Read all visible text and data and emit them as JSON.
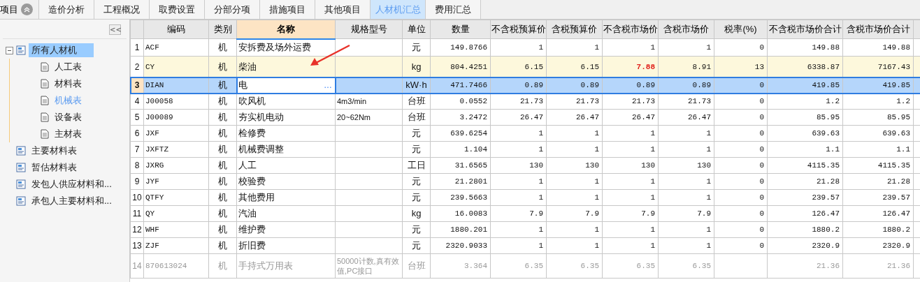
{
  "tabs": {
    "cut_label": "项目",
    "items": [
      {
        "label": "造价分析",
        "selected": false
      },
      {
        "label": "工程概况",
        "selected": false
      },
      {
        "label": "取费设置",
        "selected": false
      },
      {
        "label": "分部分项",
        "selected": false
      },
      {
        "label": "措施项目",
        "selected": false
      },
      {
        "label": "其他项目",
        "selected": false
      },
      {
        "label": "人材机汇总",
        "selected": true
      },
      {
        "label": "费用汇总",
        "selected": false
      }
    ]
  },
  "sidebar": {
    "collapse_button": "<<",
    "tree": [
      {
        "label": "所有人材机",
        "kind": "group",
        "selected": true,
        "active": false,
        "expanded": true,
        "children": [
          {
            "label": "人工表",
            "kind": "page",
            "selected": false,
            "active": false
          },
          {
            "label": "材料表",
            "kind": "page",
            "selected": false,
            "active": false
          },
          {
            "label": "机械表",
            "kind": "page",
            "selected": false,
            "active": true
          },
          {
            "label": "设备表",
            "kind": "page",
            "selected": false,
            "active": false
          },
          {
            "label": "主材表",
            "kind": "page",
            "selected": false,
            "active": false
          }
        ]
      },
      {
        "label": "主要材料表",
        "kind": "group",
        "selected": false,
        "active": false
      },
      {
        "label": "暂估材料表",
        "kind": "group",
        "selected": false,
        "active": false
      },
      {
        "label": "发包人供应材料和...",
        "kind": "group",
        "selected": false,
        "active": false
      },
      {
        "label": "承包人主要材料和...",
        "kind": "group",
        "selected": false,
        "active": false
      }
    ]
  },
  "table": {
    "columns": [
      {
        "label": "编码",
        "sorted": false
      },
      {
        "label": "类别",
        "sorted": false
      },
      {
        "label": "名称",
        "sorted": true
      },
      {
        "label": "规格型号",
        "sorted": false
      },
      {
        "label": "单位",
        "sorted": false
      },
      {
        "label": "数量",
        "sorted": false
      },
      {
        "label": "不含税预算价",
        "sorted": false
      },
      {
        "label": "含税预算价",
        "sorted": false
      },
      {
        "label": "不含税市场价",
        "sorted": false
      },
      {
        "label": "含税市场价",
        "sorted": false
      },
      {
        "label": "税率(%)",
        "sorted": false
      },
      {
        "label": "不含税市场价合计",
        "sorted": false
      },
      {
        "label": "含税市场价合计",
        "sorted": false
      }
    ],
    "edit_button": "…",
    "rows": [
      {
        "num": "1",
        "selected": false,
        "highlighted": false,
        "disabled": false,
        "price_changed": false,
        "cells": [
          "ACF",
          "机",
          "安拆费及场外运费",
          "",
          "元",
          "149.8766",
          "1",
          "1",
          "1",
          "1",
          "0",
          "149.88",
          "149.88"
        ]
      },
      {
        "num": "2",
        "selected": false,
        "highlighted": true,
        "disabled": false,
        "price_changed": true,
        "cells": [
          "CY",
          "机",
          "柴油",
          "",
          "kg",
          "804.4251",
          "6.15",
          "6.15",
          "7.88",
          "8.91",
          "13",
          "6338.87",
          "7167.43"
        ]
      },
      {
        "num": "3",
        "selected": true,
        "highlighted": false,
        "disabled": false,
        "price_changed": false,
        "cells": [
          "DIAN",
          "机",
          "电",
          "",
          "kW·h",
          "471.7466",
          "0.89",
          "0.89",
          "0.89",
          "0.89",
          "0",
          "419.85",
          "419.85"
        ]
      },
      {
        "num": "4",
        "selected": false,
        "highlighted": false,
        "disabled": false,
        "price_changed": false,
        "cells": [
          "J00058",
          "机",
          "吹风机",
          "4m3/min",
          "台班",
          "0.0552",
          "21.73",
          "21.73",
          "21.73",
          "21.73",
          "0",
          "1.2",
          "1.2"
        ]
      },
      {
        "num": "5",
        "selected": false,
        "highlighted": false,
        "disabled": false,
        "price_changed": false,
        "cells": [
          "J00089",
          "机",
          "夯实机电动",
          "20~62Nm",
          "台班",
          "3.2472",
          "26.47",
          "26.47",
          "26.47",
          "26.47",
          "0",
          "85.95",
          "85.95"
        ]
      },
      {
        "num": "6",
        "selected": false,
        "highlighted": false,
        "disabled": false,
        "price_changed": false,
        "cells": [
          "JXF",
          "机",
          "检修费",
          "",
          "元",
          "639.6254",
          "1",
          "1",
          "1",
          "1",
          "0",
          "639.63",
          "639.63"
        ]
      },
      {
        "num": "7",
        "selected": false,
        "highlighted": false,
        "disabled": false,
        "price_changed": false,
        "cells": [
          "JXFTZ",
          "机",
          "机械费调整",
          "",
          "元",
          "1.104",
          "1",
          "1",
          "1",
          "1",
          "0",
          "1.1",
          "1.1"
        ]
      },
      {
        "num": "8",
        "selected": false,
        "highlighted": false,
        "disabled": false,
        "price_changed": false,
        "cells": [
          "JXRG",
          "机",
          "人工",
          "",
          "工日",
          "31.6565",
          "130",
          "130",
          "130",
          "130",
          "0",
          "4115.35",
          "4115.35"
        ]
      },
      {
        "num": "9",
        "selected": false,
        "highlighted": false,
        "disabled": false,
        "price_changed": false,
        "cells": [
          "JYF",
          "机",
          "校验费",
          "",
          "元",
          "21.2801",
          "1",
          "1",
          "1",
          "1",
          "0",
          "21.28",
          "21.28"
        ]
      },
      {
        "num": "10",
        "selected": false,
        "highlighted": false,
        "disabled": false,
        "price_changed": false,
        "cells": [
          "QTFY",
          "机",
          "其他费用",
          "",
          "元",
          "239.5663",
          "1",
          "1",
          "1",
          "1",
          "0",
          "239.57",
          "239.57"
        ]
      },
      {
        "num": "11",
        "selected": false,
        "highlighted": false,
        "disabled": false,
        "price_changed": false,
        "cells": [
          "QY",
          "机",
          "汽油",
          "",
          "kg",
          "16.0083",
          "7.9",
          "7.9",
          "7.9",
          "7.9",
          "0",
          "126.47",
          "126.47"
        ]
      },
      {
        "num": "12",
        "selected": false,
        "highlighted": false,
        "disabled": false,
        "price_changed": false,
        "cells": [
          "WHF",
          "机",
          "维护费",
          "",
          "元",
          "1880.201",
          "1",
          "1",
          "1",
          "1",
          "0",
          "1880.2",
          "1880.2"
        ]
      },
      {
        "num": "13",
        "selected": false,
        "highlighted": false,
        "disabled": false,
        "price_changed": false,
        "cells": [
          "ZJF",
          "机",
          "折旧费",
          "",
          "元",
          "2320.9033",
          "1",
          "1",
          "1",
          "1",
          "0",
          "2320.9",
          "2320.9"
        ]
      },
      {
        "num": "14",
        "selected": false,
        "highlighted": false,
        "disabled": true,
        "price_changed": false,
        "cells": [
          "870613024",
          "机",
          "手持式万用表",
          "50000计数,真有效值,PC接口",
          "台班",
          "3.364",
          "6.35",
          "6.35",
          "6.35",
          "6.35",
          "",
          "21.36",
          "21.36"
        ]
      }
    ]
  }
}
